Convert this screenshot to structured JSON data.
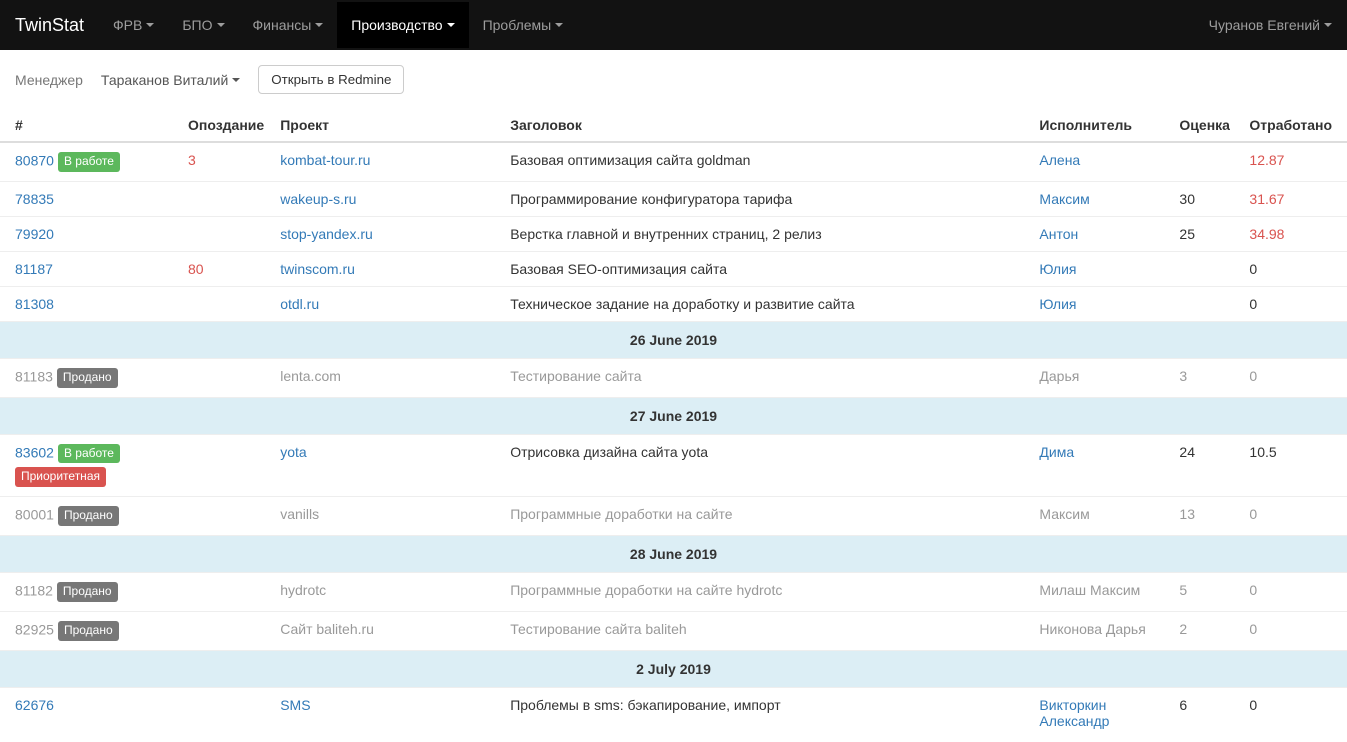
{
  "navbar": {
    "brand": "TwinStat",
    "items": [
      {
        "label": "ФРВ"
      },
      {
        "label": "БПО"
      },
      {
        "label": "Финансы"
      },
      {
        "label": "Производство",
        "active": true
      },
      {
        "label": "Проблемы"
      }
    ],
    "user": "Чуранов Евгений"
  },
  "toolbar": {
    "managerLabel": "Менеджер",
    "managerValue": "Тараканов Виталий",
    "openRedmine": "Открыть в Redmine"
  },
  "columns": {
    "id": "#",
    "late": "Опоздание",
    "project": "Проект",
    "title": "Заголовок",
    "executor": "Исполнитель",
    "estimate": "Оценка",
    "worked": "Отработано"
  },
  "rows": [
    {
      "type": "task",
      "id": "80870",
      "badges": [
        {
          "text": "В работе",
          "color": "green"
        }
      ],
      "late": "3",
      "lateRed": true,
      "project": "kombat-tour.ru",
      "title": "Базовая оптимизация сайта goldman",
      "executor": "Алена",
      "estimate": "",
      "worked": "12.87",
      "workedRed": true,
      "muted": false
    },
    {
      "type": "task",
      "id": "78835",
      "badges": [],
      "late": "",
      "project": "wakeup-s.ru",
      "title": "Программирование конфигуратора тарифа",
      "executor": "Максим",
      "estimate": "30",
      "worked": "31.67",
      "workedRed": true,
      "muted": false
    },
    {
      "type": "task",
      "id": "79920",
      "badges": [],
      "late": "",
      "project": "stop-yandex.ru",
      "title": "Верстка главной и внутренних страниц, 2 релиз",
      "executor": "Антон",
      "estimate": "25",
      "worked": "34.98",
      "workedRed": true,
      "muted": false
    },
    {
      "type": "task",
      "id": "81187",
      "badges": [],
      "late": "80",
      "lateRed": true,
      "project": "twinscom.ru",
      "title": "Базовая SEO-оптимизация сайта",
      "executor": "Юлия",
      "estimate": "",
      "worked": "0",
      "workedRed": false,
      "muted": false
    },
    {
      "type": "task",
      "id": "81308",
      "badges": [],
      "late": "",
      "project": "otdl.ru",
      "title": "Техническое задание на доработку и развитие сайта",
      "executor": "Юлия",
      "estimate": "",
      "worked": "0",
      "workedRed": false,
      "muted": false
    },
    {
      "type": "date",
      "label": "26 June 2019"
    },
    {
      "type": "task",
      "id": "81183",
      "badges": [
        {
          "text": "Продано",
          "color": "grey"
        }
      ],
      "late": "",
      "project": "lenta.com",
      "title": "Тестирование сайта",
      "executor": "Дарья",
      "estimate": "3",
      "worked": "0",
      "workedRed": false,
      "muted": true
    },
    {
      "type": "date",
      "label": "27 June 2019"
    },
    {
      "type": "task",
      "id": "83602",
      "badges": [
        {
          "text": "В работе",
          "color": "green"
        }
      ],
      "extraBadge": {
        "text": "Приоритетная",
        "color": "red"
      },
      "late": "",
      "project": "yota",
      "title": "Отрисовка дизайна сайта yota",
      "executor": "Дима",
      "estimate": "24",
      "worked": "10.5",
      "workedRed": false,
      "muted": false
    },
    {
      "type": "task",
      "id": "80001",
      "badges": [
        {
          "text": "Продано",
          "color": "grey"
        }
      ],
      "late": "",
      "project": "vanills",
      "title": "Программные доработки на сайте",
      "executor": "Максим",
      "estimate": "13",
      "worked": "0",
      "workedRed": false,
      "muted": true
    },
    {
      "type": "date",
      "label": "28 June 2019"
    },
    {
      "type": "task",
      "id": "81182",
      "badges": [
        {
          "text": "Продано",
          "color": "grey"
        }
      ],
      "late": "",
      "project": "hydrotc",
      "title": "Программные доработки на сайте hydrotc",
      "executor": "Милаш Максим",
      "estimate": "5",
      "worked": "0",
      "workedRed": false,
      "muted": true
    },
    {
      "type": "task",
      "id": "82925",
      "badges": [
        {
          "text": "Продано",
          "color": "grey"
        }
      ],
      "late": "",
      "project": "Сайт baliteh.ru",
      "title": "Тестирование сайта baliteh",
      "executor": "Никонова Дарья",
      "estimate": "2",
      "worked": "0",
      "workedRed": false,
      "muted": true
    },
    {
      "type": "date",
      "label": "2 July 2019"
    },
    {
      "type": "task",
      "id": "62676",
      "badges": [],
      "late": "",
      "project": "SMS",
      "title": "Проблемы в sms: бэкапирование, импорт",
      "executor": "Викторкин Александр",
      "estimate": "6",
      "worked": "0",
      "workedRed": false,
      "muted": false
    }
  ]
}
